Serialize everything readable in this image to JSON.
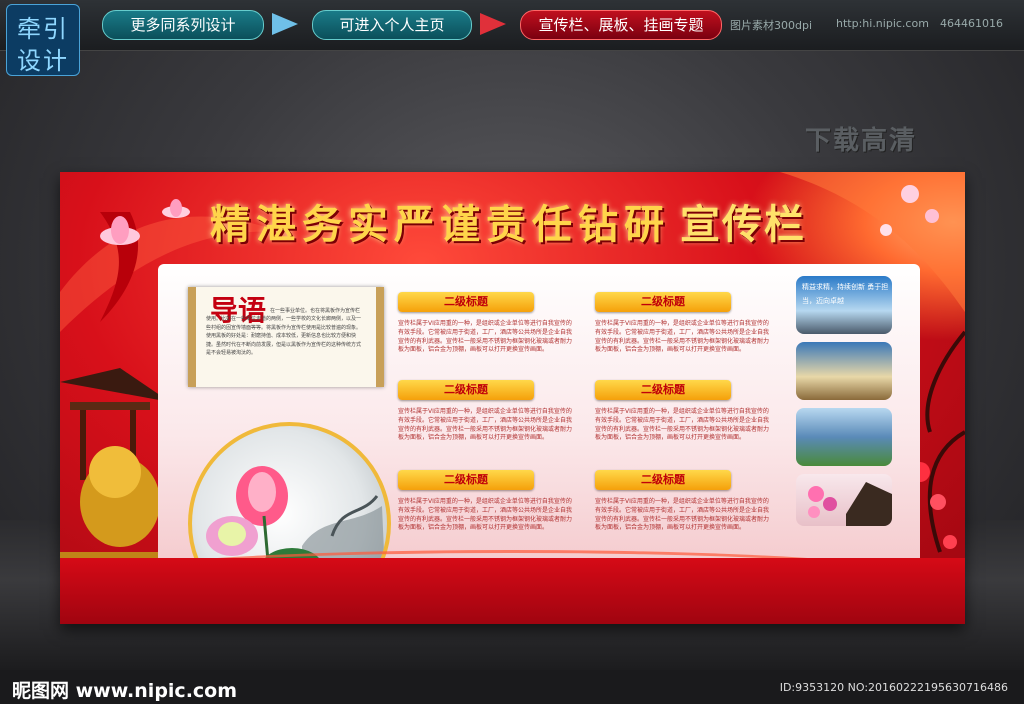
{
  "header": {
    "logo_line1": "牵引",
    "logo_line2": "设计",
    "btn_series": "更多同系列设计",
    "btn_home": "可进入个人主页",
    "btn_topic": "宣传栏、展板、挂画专题",
    "meta_material": "图片素材300dpi",
    "meta_url": "http:hi.nipic.com",
    "meta_id": "464461016"
  },
  "watermark": "下载高清",
  "board": {
    "title": "精湛务实严谨责任钻研",
    "title_suffix": "宣传栏",
    "intro_title": "导语",
    "intro_text": "在一些事业单位。也在将黑板作为宣传栏使用。比如在一些单位走道的两侧，一些学校的文化长廊两侧，以及一些村组的固宣传墙面等等。将黑板作为宣传栏使用是比较普遍的现象。使用黑板的好处是：耐磨持值、成本较低，更新信息也比较方便和快捷。虽然时代在不断向前发展，但是以黑板作为宣传栏的这种传统方式是不会轻易被淘汰的。",
    "sections": [
      {
        "heading": "二级标题",
        "text": "宣传栏属于VI应用重的一种，是组织或企业单位等进行自我宣传的有效手段。它常被应用于街道，工厂，酒店等公共场所是企业自我宣传的有利武器。宣传栏一般采用不锈钢为框架钢化玻璃或者耐力板为面板，铝合金为顶棚，画板可以打开更换宣传画面。"
      },
      {
        "heading": "二级标题",
        "text": "宣传栏属于VI应用重的一种，是组织或企业单位等进行自我宣传的有效手段。它常被应用于街道，工厂，酒店等公共场所是企业自我宣传的有利武器。宣传栏一般采用不锈钢为框架钢化玻璃或者耐力板为面板，铝合金为顶棚，画板可以打开更换宣传画面。"
      },
      {
        "heading": "二级标题",
        "text": "宣传栏属于VI应用重的一种，是组织或企业单位等进行自我宣传的有效手段。它常被应用于街道，工厂，酒店等公共场所是企业自我宣传的有利武器。宣传栏一般采用不锈钢为框架钢化玻璃或者耐力板为面板，铝合金为顶棚，画板可以打开更换宣传画面。"
      },
      {
        "heading": "二级标题",
        "text": "宣传栏属于VI应用重的一种，是组织或企业单位等进行自我宣传的有效手段。它常被应用于街道，工厂，酒店等公共场所是企业自我宣传的有利武器。宣传栏一般采用不锈钢为框架钢化玻璃或者耐力板为面板，铝合金为顶棚，画板可以打开更换宣传画面。"
      },
      {
        "heading": "二级标题",
        "text": "宣传栏属于VI应用重的一种，是组织或企业单位等进行自我宣传的有效手段。它常被应用于街道，工厂，酒店等公共场所是企业自我宣传的有利武器。宣传栏一般采用不锈钢为框架钢化玻璃或者耐力板为面板，铝合金为顶棚，画板可以打开更换宣传画面。"
      },
      {
        "heading": "二级标题",
        "text": "宣传栏属于VI应用重的一种，是组织或企业单位等进行自我宣传的有效手段。它常被应用于街道，工厂，酒店等公共场所是企业自我宣传的有利武器。宣传栏一般采用不锈钢为框架钢化玻璃或者耐力板为面板，铝合金为顶棚，画板可以打开更换宣传画面。"
      }
    ],
    "photo_caption": "精益求精，持续创新 勇于担当，迈向卓越"
  },
  "footer": {
    "site": "昵图网 www.nipic.com",
    "id": "ID:9353120 NO:20160222195630716486"
  },
  "colors": {
    "board_red": "#d8101a",
    "title_gold": "#ffd54a",
    "heading_gold": "#f5a00a",
    "accent_blue": "#0c3c63"
  }
}
